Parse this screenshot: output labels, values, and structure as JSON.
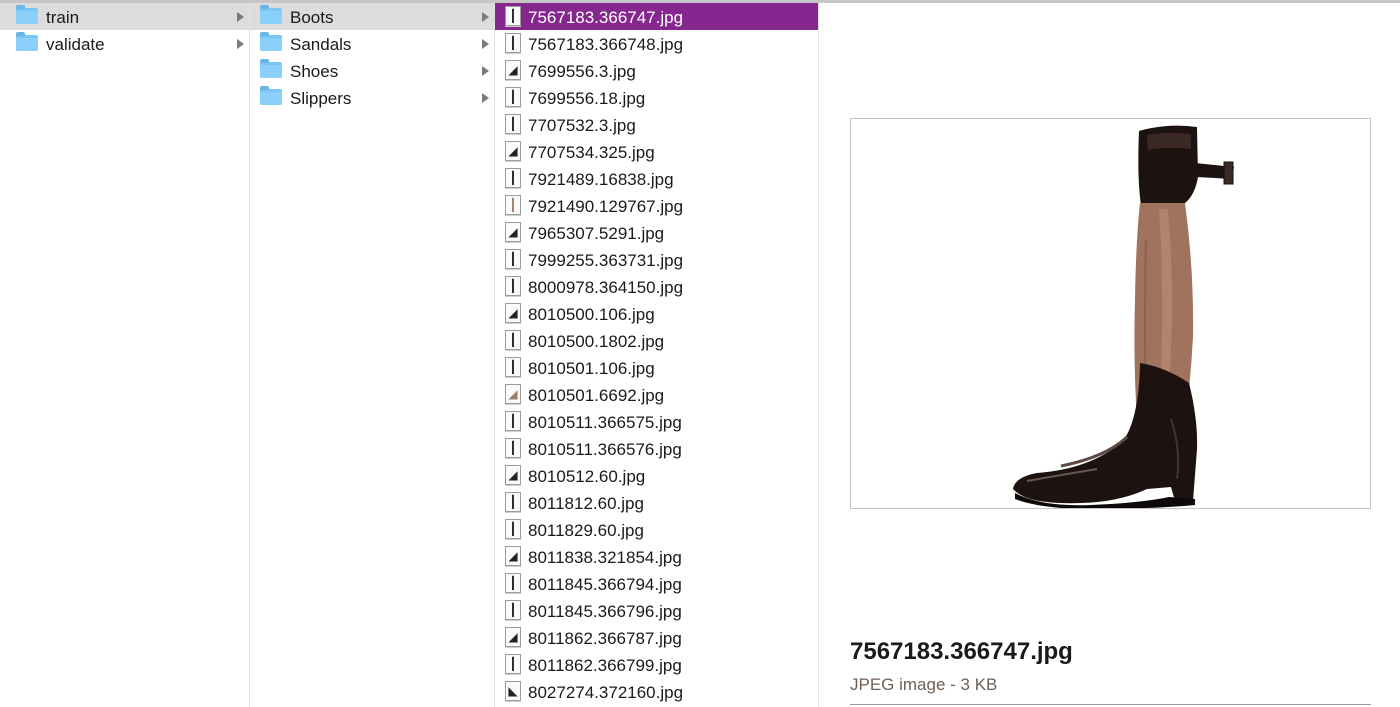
{
  "columns": {
    "col1": [
      {
        "label": "train",
        "icon": "folder-icon",
        "has_children": true,
        "selected": true
      },
      {
        "label": "validate",
        "icon": "folder-icon",
        "has_children": true,
        "selected": false
      }
    ],
    "col2": [
      {
        "label": "Boots",
        "icon": "folder-icon",
        "has_children": true,
        "selected": true
      },
      {
        "label": "Sandals",
        "icon": "folder-icon",
        "has_children": true,
        "selected": false
      },
      {
        "label": "Shoes",
        "icon": "folder-icon",
        "has_children": true,
        "selected": false
      },
      {
        "label": "Slippers",
        "icon": "folder-icon",
        "has_children": true,
        "selected": false
      }
    ],
    "col3": [
      {
        "label": "7567183.366747.jpg",
        "icon": "boot-thumbnail-icon",
        "selected": true
      },
      {
        "label": "7567183.366748.jpg",
        "icon": "boot-thumbnail-icon"
      },
      {
        "label": "7699556.3.jpg",
        "icon": "boot-thumbnail-icon"
      },
      {
        "label": "7699556.18.jpg",
        "icon": "boot-thumbnail-icon"
      },
      {
        "label": "7707532.3.jpg",
        "icon": "boot-thumbnail-icon"
      },
      {
        "label": "7707534.325.jpg",
        "icon": "boot-thumbnail-icon"
      },
      {
        "label": "7921489.16838.jpg",
        "icon": "boot-thumbnail-icon"
      },
      {
        "label": "7921490.129767.jpg",
        "icon": "boot-thumbnail-icon",
        "pale": true
      },
      {
        "label": "7965307.5291.jpg",
        "icon": "boot-thumbnail-icon"
      },
      {
        "label": "7999255.363731.jpg",
        "icon": "boot-thumbnail-icon"
      },
      {
        "label": "8000978.364150.jpg",
        "icon": "boot-thumbnail-icon"
      },
      {
        "label": "8010500.106.jpg",
        "icon": "boot-thumbnail-icon"
      },
      {
        "label": "8010500.1802.jpg",
        "icon": "boot-thumbnail-icon"
      },
      {
        "label": "8010501.106.jpg",
        "icon": "boot-thumbnail-icon"
      },
      {
        "label": "8010501.6692.jpg",
        "icon": "boot-thumbnail-icon",
        "pale": true
      },
      {
        "label": "8010511.366575.jpg",
        "icon": "boot-thumbnail-icon"
      },
      {
        "label": "8010511.366576.jpg",
        "icon": "boot-thumbnail-icon"
      },
      {
        "label": "8010512.60.jpg",
        "icon": "boot-thumbnail-icon"
      },
      {
        "label": "8011812.60.jpg",
        "icon": "boot-thumbnail-icon"
      },
      {
        "label": "8011829.60.jpg",
        "icon": "boot-thumbnail-icon"
      },
      {
        "label": "8011838.321854.jpg",
        "icon": "boot-thumbnail-icon"
      },
      {
        "label": "8011845.366794.jpg",
        "icon": "boot-thumbnail-icon"
      },
      {
        "label": "8011845.366796.jpg",
        "icon": "boot-thumbnail-icon"
      },
      {
        "label": "8011862.366787.jpg",
        "icon": "boot-thumbnail-icon"
      },
      {
        "label": "8011862.366799.jpg",
        "icon": "boot-thumbnail-icon"
      },
      {
        "label": "8027274.372160.jpg",
        "icon": "sneaker-thumbnail-icon"
      }
    ]
  },
  "preview": {
    "filename": "7567183.366747.jpg",
    "kind": "JPEG image - 3 KB",
    "image_icon": "riding-boot-image"
  },
  "colors": {
    "selection_active": "#86278f",
    "selection_inactive": "#dcdcdc",
    "folder": "#8ad0fb",
    "kind_text": "#6f5f55",
    "boot_tan": "#a0735e",
    "boot_black": "#1c1210"
  }
}
